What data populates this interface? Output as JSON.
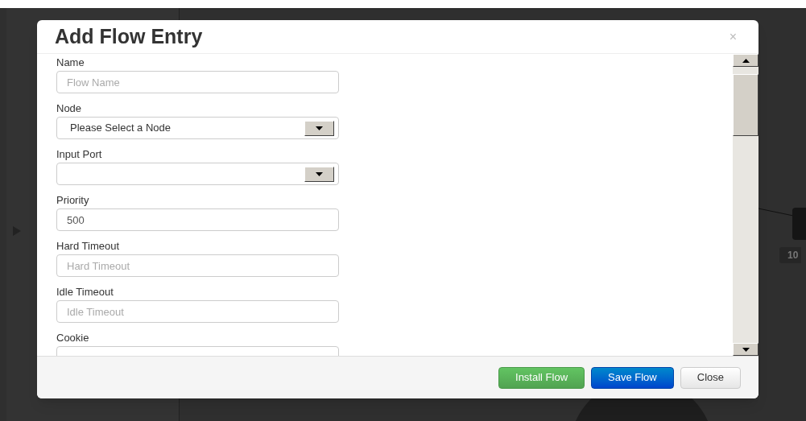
{
  "background": {
    "node_label": "10"
  },
  "dialog": {
    "title": "Add Flow Entry",
    "close": "×",
    "fields": [
      {
        "label": "Name",
        "kind": "text",
        "placeholder": "Flow Name"
      },
      {
        "label": "Node",
        "kind": "select",
        "value": "Please Select a Node"
      },
      {
        "label": "Input Port",
        "kind": "select"
      },
      {
        "label": "Priority",
        "kind": "text",
        "value": "500"
      },
      {
        "label": "Hard Timeout",
        "kind": "text",
        "placeholder": "Hard Timeout"
      },
      {
        "label": "Idle Timeout",
        "kind": "text",
        "placeholder": "Idle Timeout"
      },
      {
        "label": "Cookie",
        "kind": "text"
      }
    ],
    "buttons": [
      {
        "label": "Install Flow",
        "kind": "success"
      },
      {
        "label": "Save Flow",
        "kind": "primary"
      },
      {
        "label": "Close",
        "kind": "default"
      }
    ]
  }
}
